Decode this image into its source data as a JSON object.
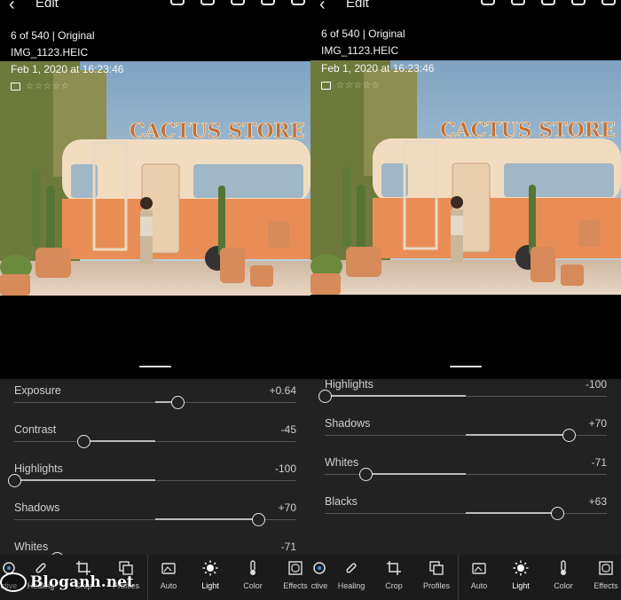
{
  "header": {
    "back_glyph": "‹",
    "mode_label": "Edit"
  },
  "left": {
    "counter": "6 of 540 | Original",
    "filename": "IMG_1123.HEIC",
    "date": "Feb 1, 2020 at 16:23:46",
    "sliders": [
      {
        "label": "Exposure",
        "value": "+0.64",
        "level": 0.58
      },
      {
        "label": "Contrast",
        "value": "-45",
        "level": 0.245
      },
      {
        "label": "Highlights",
        "value": "-100",
        "level": 0.0
      },
      {
        "label": "Shadows",
        "value": "+70",
        "level": 0.865
      },
      {
        "label": "Whites",
        "value": "-71",
        "level": 0.15
      }
    ]
  },
  "right": {
    "counter": "6 of 540 | Original",
    "filename": "IMG_1123.HEIC",
    "date": "Feb 1, 2020 at 16:23:46",
    "sliders": [
      {
        "label": "Highlights",
        "value": "-100",
        "level": 0.0
      },
      {
        "label": "Shadows",
        "value": "+70",
        "level": 0.865
      },
      {
        "label": "Whites",
        "value": "-71",
        "level": 0.145
      },
      {
        "label": "Blacks",
        "value": "+63",
        "level": 0.825
      }
    ]
  },
  "sign_text": "CACTUS STORE",
  "toolbar_left": [
    {
      "label": "ctive",
      "icon": "selective-icon"
    },
    {
      "label": "Healing",
      "icon": "healing-icon"
    },
    {
      "label": "Crop",
      "icon": "crop-icon"
    },
    {
      "label": "Profiles",
      "icon": "profiles-icon"
    },
    {
      "label": "Auto",
      "icon": "auto-icon"
    },
    {
      "label": "Light",
      "icon": "light-icon",
      "active": true
    },
    {
      "label": "Color",
      "icon": "color-icon"
    },
    {
      "label": "Effects",
      "icon": "effects-icon"
    }
  ],
  "toolbar_right": [
    {
      "label": "ctive",
      "icon": "selective-icon"
    },
    {
      "label": "Healing",
      "icon": "healing-icon"
    },
    {
      "label": "Crop",
      "icon": "crop-icon"
    },
    {
      "label": "Profiles",
      "icon": "profiles-icon"
    },
    {
      "label": "Auto",
      "icon": "auto-icon"
    },
    {
      "label": "Light",
      "icon": "light-icon",
      "active": true
    },
    {
      "label": "Color",
      "icon": "color-icon"
    },
    {
      "label": "Effects",
      "icon": "effects-icon"
    }
  ],
  "watermark": "Bloganh.net",
  "colors": {
    "panel_bg": "#222222",
    "toolbar_bg": "#1b1b1b",
    "van_orange": "#e98d56",
    "van_cream": "#f2dcc0"
  }
}
